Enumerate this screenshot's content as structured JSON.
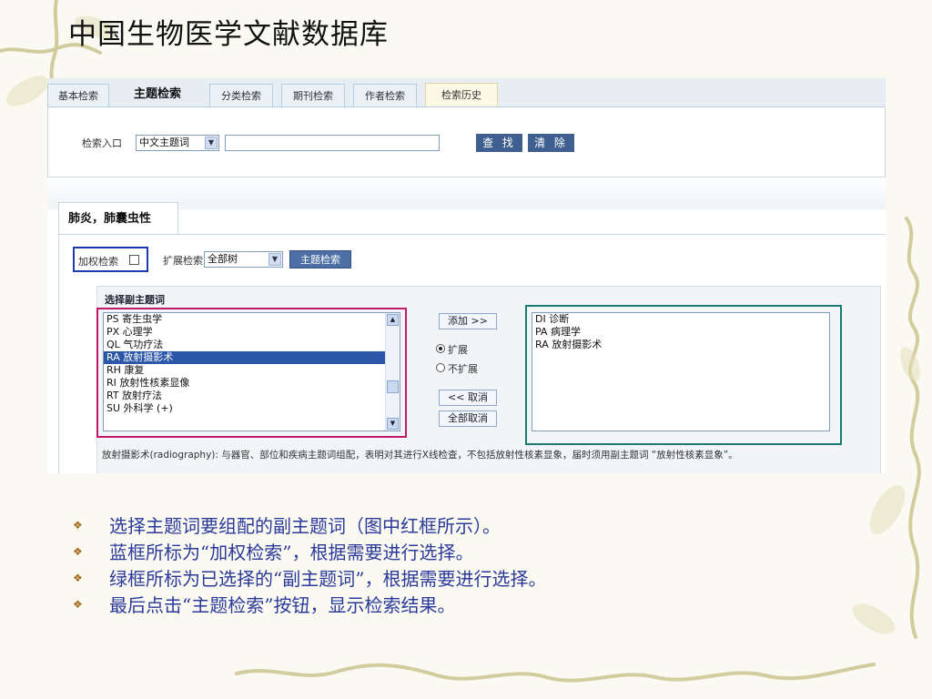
{
  "slide": {
    "title": "中国生物医学文献数据库",
    "bullets": [
      "选择主题词要组配的副主题词（图中红框所示）。",
      "蓝框所标为“加权检索”，根据需要进行选择。",
      "绿框所标为已选择的“副主题词”，根据需要进行选择。",
      "最后点击“主题检索”按钮，显示检索结果。"
    ],
    "bullet_icon": "diamond-bullet-icon"
  },
  "tabs": [
    "基本检索",
    "主题检索",
    "分类检索",
    "期刊检索",
    "作者检索",
    "检索历史"
  ],
  "active_tab": "主题检索",
  "search": {
    "entry_label": "检索入口",
    "entry_value": "中文主题词",
    "input_value": "",
    "find_button": "查 找",
    "clear_button": "清 除"
  },
  "term": {
    "tab_label": "肺炎，肺囊虫性",
    "weight_label": "加权检索",
    "weight_checked": false,
    "expand_label": "扩展检索",
    "expand_value": "全部树",
    "subject_search_button": "主题检索"
  },
  "subheadings": {
    "title": "选择副主题词",
    "available": [
      {
        "code": "PS",
        "text": "PS 寄生虫学",
        "selected": false
      },
      {
        "code": "PX",
        "text": "PX 心理学",
        "selected": false
      },
      {
        "code": "QL",
        "text": "QL 气功疗法",
        "selected": false
      },
      {
        "code": "RA",
        "text": "RA 放射摄影术",
        "selected": true
      },
      {
        "code": "RH",
        "text": "RH 康复",
        "selected": false
      },
      {
        "code": "RI",
        "text": "RI 放射性核素显像",
        "selected": false
      },
      {
        "code": "RT",
        "text": "RT 放射疗法",
        "selected": false
      },
      {
        "code": "SU",
        "text": "SU 外科学 (+)",
        "selected": false
      }
    ],
    "add_button": "添加 >>",
    "radio_expand": "扩展",
    "radio_no_expand": "不扩展",
    "expand_selected": "扩展",
    "cancel_button": "<< 取消",
    "cancel_all_button": "全部取消",
    "chosen": [
      "DI 诊断",
      "PA 病理学",
      "RA 放射摄影术"
    ],
    "description": "放射摄影术(radiography): 与器官、部位和疾病主题词组配，表明对其进行X线检查，不包括放射性核素显象，届时须用副主题词 “放射性核素显象”。"
  },
  "frames": {
    "blue": "#1f3ab0",
    "red": "#c2186b",
    "green": "#1a7a6e"
  }
}
